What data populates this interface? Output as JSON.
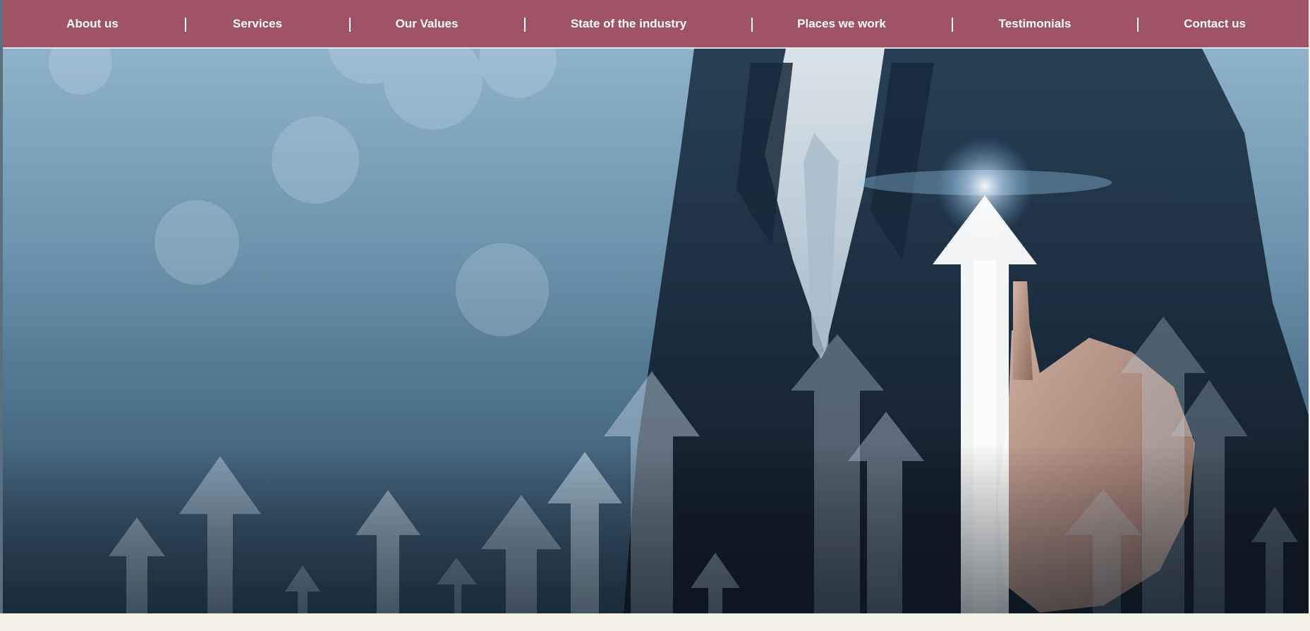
{
  "nav": {
    "items": [
      {
        "label": "About us"
      },
      {
        "label": "Services"
      },
      {
        "label": "Our Values"
      },
      {
        "label": "State of the industry"
      },
      {
        "label": "Places we work"
      },
      {
        "label": "Testimonials"
      },
      {
        "label": "Contact us"
      }
    ],
    "background_color": "#a05266",
    "text_color": "#ffffff"
  },
  "hero": {
    "image": "businessman-pointing-growth-arrows-image",
    "accent_color": "#4b6f8c"
  },
  "footer": {
    "background_color": "#f3f0e6"
  }
}
